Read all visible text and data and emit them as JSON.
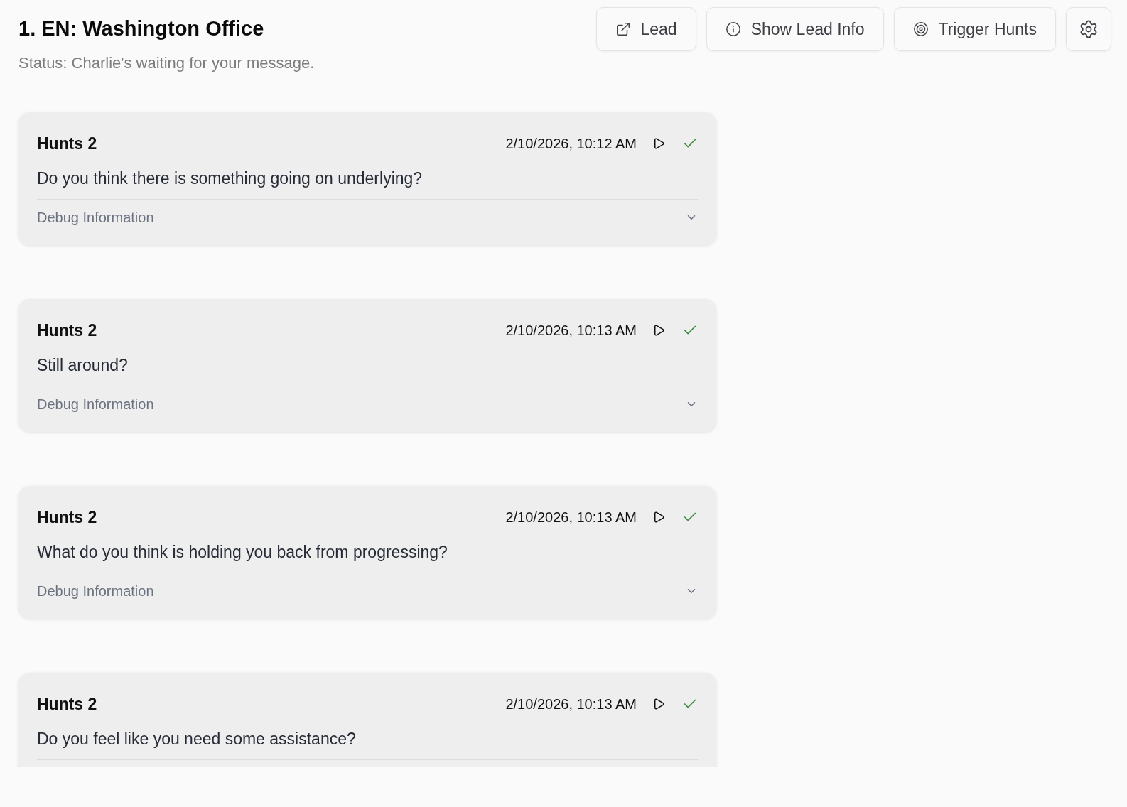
{
  "header": {
    "title": "1. EN: Washington Office",
    "status": "Status: Charlie's waiting for your message."
  },
  "actions": [
    {
      "kind": "link",
      "label": "Lead"
    },
    {
      "kind": "info",
      "label": "Show Lead Info"
    },
    {
      "kind": "trigger",
      "label": "Trigger Hunts"
    },
    {
      "kind": "settings"
    }
  ],
  "messages": [
    {
      "sender": "Hunts 2",
      "timestamp": "2/10/2026, 10:12 AM",
      "delivered": true,
      "text": "Do you think there is something going on underlying?",
      "debug": {
        "label": "Debug Information",
        "expanded": false
      }
    },
    {
      "sender": "Hunts 2",
      "timestamp": "2/10/2026, 10:13 AM",
      "delivered": true,
      "text": "Still around?",
      "debug": {
        "label": "Debug Information",
        "expanded": false
      }
    },
    {
      "sender": "Hunts 2",
      "timestamp": "2/10/2026, 10:13 AM",
      "delivered": true,
      "text": "What do you think is holding you back from progressing?",
      "debug": {
        "label": "Debug Information",
        "expanded": false
      }
    },
    {
      "sender": "Hunts 2",
      "timestamp": "2/10/2026, 10:13 AM",
      "delivered": true,
      "text": "Do you feel like you need some assistance?"
    }
  ]
}
